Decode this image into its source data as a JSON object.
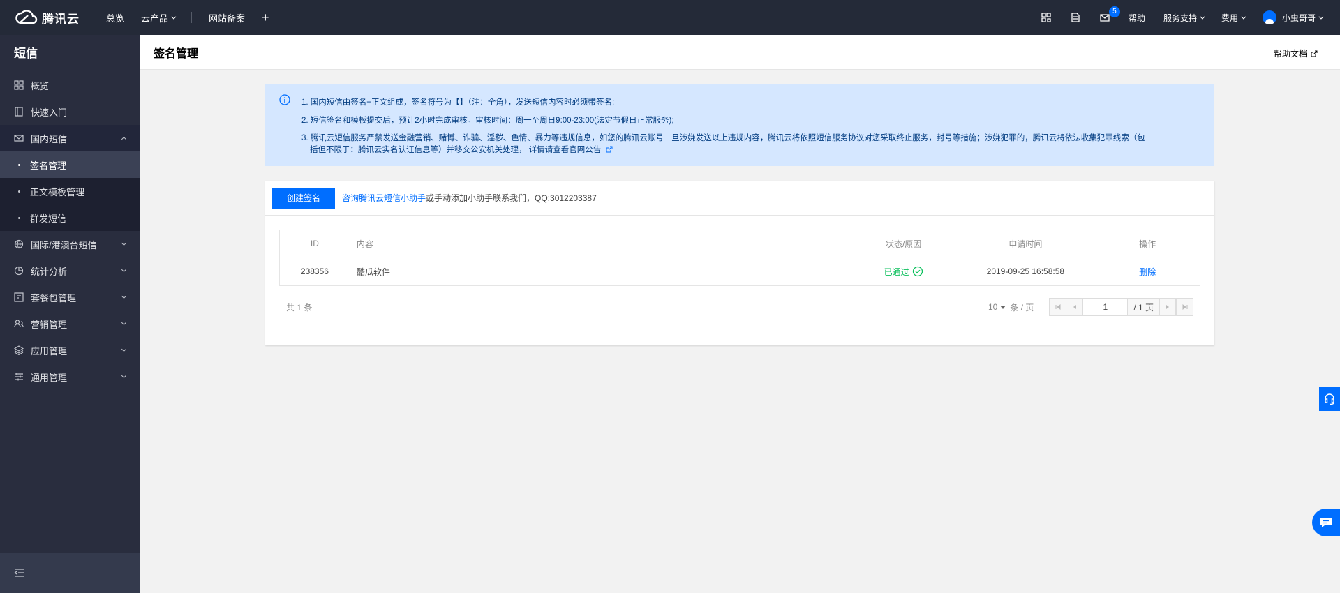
{
  "topbar": {
    "brand": "腾讯云",
    "nav": [
      "总览",
      "云产品",
      "网站备案"
    ],
    "right": {
      "mail_badge": "5",
      "help": "帮助",
      "support": "服务支持",
      "billing": "费用",
      "user": "小虫哥哥"
    }
  },
  "sidebar": {
    "title": "短信",
    "items": [
      {
        "label": "概览",
        "icon": "grid-icon"
      },
      {
        "label": "快速入门",
        "icon": "book-icon"
      },
      {
        "label": "国内短信",
        "icon": "mail-icon"
      },
      {
        "label": "国际/港澳台短信",
        "icon": "globe-icon"
      },
      {
        "label": "统计分析",
        "icon": "pie-chart-icon"
      },
      {
        "label": "套餐包管理",
        "icon": "package-icon"
      },
      {
        "label": "营销管理",
        "icon": "users-icon"
      },
      {
        "label": "应用管理",
        "icon": "layers-icon"
      },
      {
        "label": "通用管理",
        "icon": "sliders-icon"
      }
    ],
    "submenu": [
      "签名管理",
      "正文模板管理",
      "群发短信"
    ]
  },
  "page": {
    "title": "签名管理",
    "help_doc": "帮助文档"
  },
  "notice": {
    "line1": "1. 国内短信由签名+正文组成，签名符号为【】（注：全角），发送短信内容时必须带签名;",
    "line2": "2. 短信签名和模板提交后，预计2小时完成审核。审核时间：周一至周日9:00-23:00(法定节假日正常服务);",
    "line3a": "3. 腾讯云短信服务严禁发送金融营销、赌博、诈骗、淫秽、色情、暴力等违规信息，如您的腾讯云账号一旦涉嫌发送以上违规内容，腾讯云将依照短信服务协议对您采取终止服务，封号等措施；涉嫌犯罪的，腾讯云将依法收集犯罪线索（包",
    "line3b": "括但不限于：腾讯云实名认证信息等）并移交公安机关处理，",
    "line3_link": "详情请查看官网公告"
  },
  "card": {
    "create_button": "创建签名",
    "hint_link": "咨询腾讯云短信小助手",
    "hint_text": "或手动添加小助手联系我们，QQ:3012203387"
  },
  "table": {
    "headers": {
      "id": "ID",
      "content": "内容",
      "status": "状态/原因",
      "time": "申请时间",
      "op": "操作"
    },
    "rows": [
      {
        "id": "238356",
        "content": "酷瓜软件",
        "status": "已通过",
        "time": "2019-09-25 16:58:58",
        "op": "删除"
      }
    ]
  },
  "pager": {
    "total": "共 1 条",
    "page_size": "10",
    "per_page": "条 / 页",
    "current_page": "1",
    "total_pages": "/ 1 页"
  },
  "colors": {
    "accent": "#006eff",
    "success": "#0abf5b",
    "topbar": "#242a38",
    "sidebar": "#292d3e"
  }
}
